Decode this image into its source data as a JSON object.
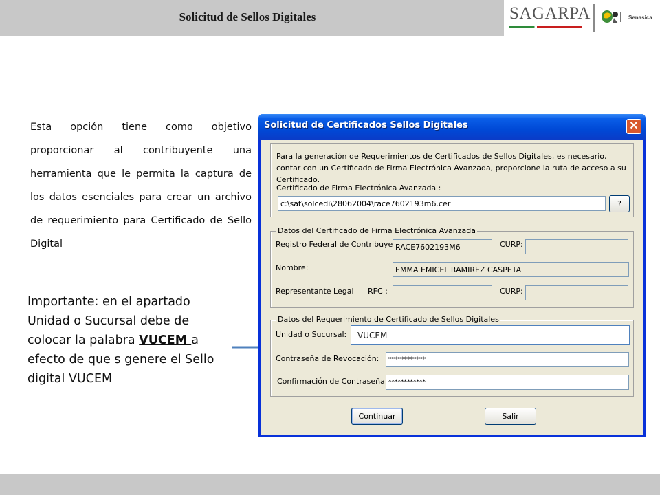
{
  "header": {
    "title": "Solicitud de Sellos Digitales",
    "logo_primary": "SAGARPA",
    "logo_secondary": "Senasica"
  },
  "description": "Esta opción tiene como objetivo proporcionar al contribuyente una herramienta que le permita la captura de los datos esenciales para crear un archivo de requerimiento para Certificado de Sello Digital",
  "important_note": {
    "before": "Importante: en el apartado Unidad o Sucursal debe de colocar la palabra ",
    "keyword": "VUCEM ",
    "after": "a efecto de que s genere el Sello digital VUCEM"
  },
  "dialog": {
    "title": "Solicitud de Certificados Sellos Digitales",
    "close_label": "✕",
    "intro": {
      "text": "Para la generación de Requerimientos de Certificados de Sellos Digitales, es necesario, contar con un Certificado de Firma Electrónica Avanzada, proporcione la ruta de acceso a su Certificado.",
      "cert_label": "Certificado de Firma Electrónica Avanzada :",
      "cert_path": "c:\\sat\\solcedi\\28062004\\race7602193m6.cer",
      "browse_label": "?"
    },
    "cert_data": {
      "legend": "Datos del Certificado de Firma Electrónica Avanzada",
      "rfc_label": "Registro Federal de Contribuyente:",
      "rfc_value": "RACE7602193M6",
      "curp_label": "CURP:",
      "curp_value": "",
      "name_label": "Nombre:",
      "name_value": "EMMA EMICEL RAMIREZ CASPETA",
      "rep_label": "Representante Legal",
      "rep_rfc_label": "RFC :",
      "rep_rfc_value": "",
      "rep_curp_label": "CURP:",
      "rep_curp_value": ""
    },
    "request_data": {
      "legend": "Datos del Requerimiento de Certificado de Sellos Digitales",
      "unit_label": "Unidad o Sucursal:",
      "unit_value": "VUCEM",
      "revocation_label": "Contraseña de Revocación:",
      "revocation_value": "************",
      "confirm_label": "Confirmación de Contraseña:",
      "confirm_value": "************"
    },
    "buttons": {
      "continue_label": "Continuar",
      "exit_label": "Salir"
    }
  },
  "colors": {
    "band": "#c8c8c8",
    "titlebar": "#0049d6",
    "arrow": "#4f81bd"
  }
}
